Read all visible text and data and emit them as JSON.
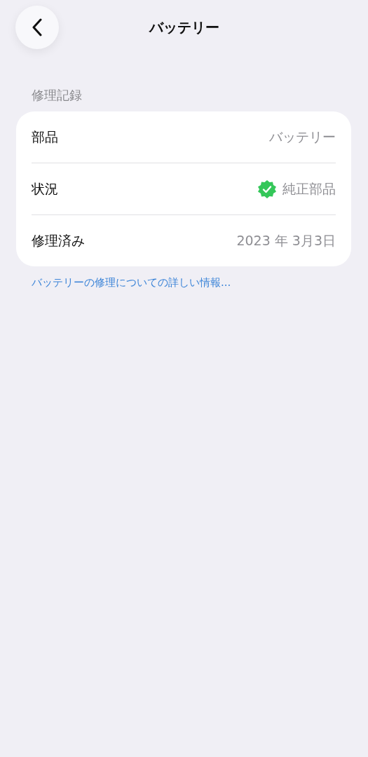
{
  "nav": {
    "title": "バッテリー"
  },
  "section": {
    "header": "修理記録",
    "rows": [
      {
        "label": "部品",
        "value": "バッテリー",
        "kind": "plain"
      },
      {
        "label": "状況",
        "value": "純正部品",
        "kind": "verified"
      },
      {
        "label": "修理済み",
        "value": "2023 年 3月3日",
        "kind": "plain"
      }
    ],
    "link": "バッテリーの修理についての詳しい情報..."
  }
}
